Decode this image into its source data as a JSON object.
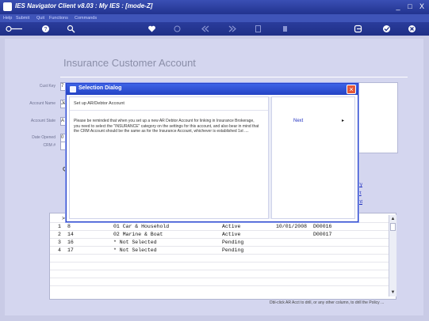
{
  "window": {
    "title": "IES Navigator Client v8.03 : My IES :      [mode-Z]",
    "controls": [
      "_",
      "□",
      "X"
    ]
  },
  "menu": {
    "items": [
      "Help",
      "Submit",
      "Quit",
      "Functions",
      "Commands"
    ]
  },
  "toolbar": {
    "icons": [
      "back-key-icon",
      "help-icon",
      "search-icon",
      "heart-icon",
      "refresh-icon",
      "rewind-icon",
      "forward-icon",
      "document-icon",
      "trash-icon",
      "exit-icon",
      "check-icon",
      "close-icon"
    ]
  },
  "page": {
    "title": "Insurance Customer Account"
  },
  "form": {
    "fields": [
      {
        "label": "Cust Key",
        "value": "7"
      },
      {
        "label": "Account Name",
        "value": "Je"
      },
      {
        "label": "Account State",
        "value": "A"
      },
      {
        "label": "Date Opened",
        "value": "0"
      },
      {
        "label": "CRM #",
        "value": ""
      }
    ],
    "section_label": "Q",
    "links": [
      "ry",
      "rt",
      "nt"
    ]
  },
  "grid": {
    "rows": [
      {
        "num": "1",
        "col1": "8",
        "desc": "01 Car & Household",
        "status": "Active",
        "date": "10/01/2008",
        "code": "D00016"
      },
      {
        "num": "2",
        "col1": "14",
        "desc": "02 Marine & Boat",
        "status": "Active",
        "date": "",
        "code": "D00017"
      },
      {
        "num": "3",
        "col1": "16",
        "desc": "* Not Selected",
        "status": "Pending",
        "date": "",
        "code": ""
      },
      {
        "num": "4",
        "col1": "17",
        "desc": "* Not Selected",
        "status": "Pending",
        "date": "",
        "code": ""
      }
    ],
    "header_marker": ">"
  },
  "status": {
    "text": "Dbl-click AR Acct to drill, or any other column, to drill the Policy ..."
  },
  "dialog": {
    "title": "Selection Dialog",
    "heading": "Set up AR/Debtor Account",
    "message": "Please be reminded that when you set up a new AR Debtor Account for linking in Insurance Brokerage, you need to select the \"INSURANCE\" category on the settings for this account, and also bear in mind that the CRM Account should be the same as for the Insurance Account, whichever is established 1st ....",
    "next_label": "Next",
    "next_arrow": "▸"
  },
  "colors": {
    "titlebar": "#22338f",
    "background": "#d4d6ef",
    "dialog_title": "#2443c4",
    "link": "#2030c0"
  }
}
